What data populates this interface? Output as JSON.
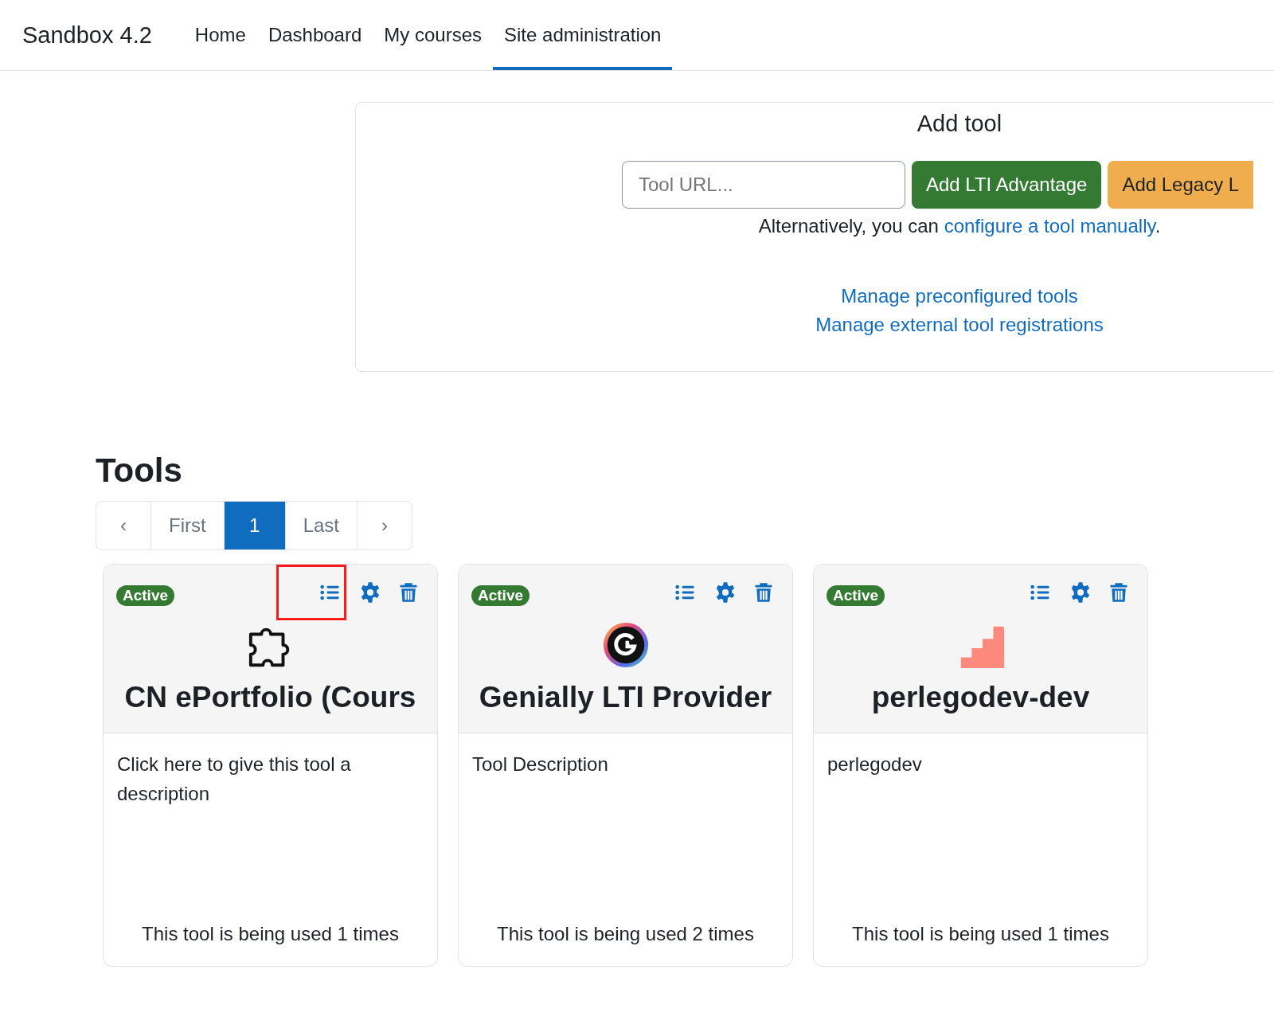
{
  "navbar": {
    "brand": "Sandbox 4.2",
    "items": [
      {
        "label": "Home",
        "selected": false
      },
      {
        "label": "Dashboard",
        "selected": false
      },
      {
        "label": "My courses",
        "selected": false
      },
      {
        "label": "Site administration",
        "selected": true
      }
    ]
  },
  "add_tool": {
    "title": "Add tool",
    "url_field": {
      "placeholder": "Tool URL..."
    },
    "buttons": [
      {
        "label": "Add LTI Advantage",
        "kind": "primary"
      },
      {
        "label": "Add Legacy L",
        "kind": "warning"
      }
    ],
    "alt_text": "Alternatively, you can ",
    "alt_link": "configure a tool manually",
    "alt_end": ".",
    "links": [
      "Manage preconfigured tools",
      "Manage external tool registrations"
    ]
  },
  "tools": {
    "title": "Tools",
    "pagination": {
      "prev": "‹",
      "first": "First",
      "pages": [
        {
          "label": "1",
          "selected": true
        }
      ],
      "last": "Last",
      "next": "›"
    },
    "cards": [
      {
        "status": "Active",
        "logo": {
          "kind": "puzzle"
        },
        "name": "CN ePortfolio (Cours",
        "description": "Click here to give this tool a description",
        "usage": "This tool is being used 1 times",
        "highlighted_action": true
      },
      {
        "status": "Active",
        "logo": {
          "kind": "genially"
        },
        "name": "Genially LTI Provider",
        "description": "Tool Description",
        "usage": "This tool is being used 2 times",
        "highlighted_action": false
      },
      {
        "status": "Active",
        "logo": {
          "kind": "steps"
        },
        "name": "perlegodev-dev",
        "description": "perlegodev",
        "usage": "This tool is being used 1 times",
        "highlighted_action": false
      }
    ]
  }
}
